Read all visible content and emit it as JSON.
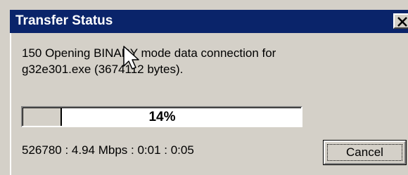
{
  "window": {
    "title": "Transfer Status",
    "title_bar_color": "#0a246a",
    "close_icon": "close-icon"
  },
  "message": {
    "line1": "150 Opening BINARY mode data connection for",
    "line2": "g32e301.exe (3674112 bytes)."
  },
  "progress": {
    "percent_label": "14%",
    "fraction": 0.14
  },
  "stats": {
    "text": "526780 : 4.94 Mbps : 0:01 : 0:05"
  },
  "buttons": {
    "cancel_label": "Cancel"
  },
  "cursor": {
    "icon": "mouse-pointer-icon"
  }
}
